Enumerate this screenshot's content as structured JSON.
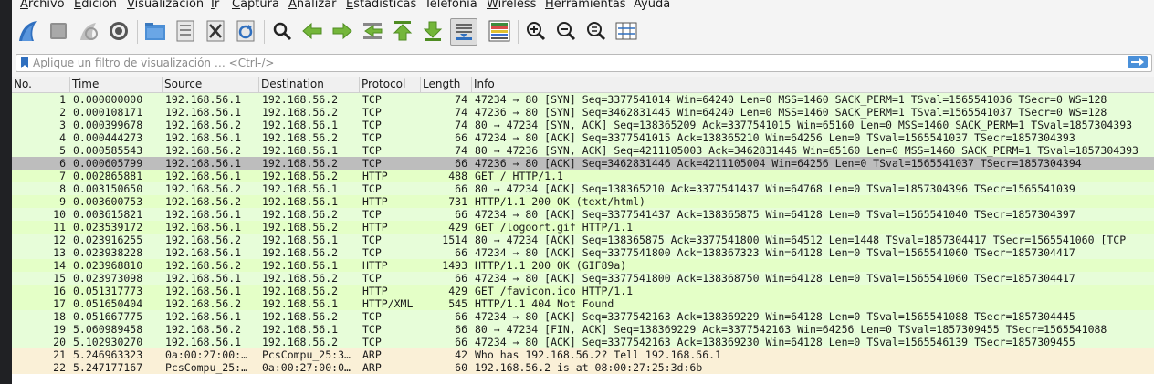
{
  "menu": [
    {
      "mnemonic": "A",
      "rest": "rchivo"
    },
    {
      "mnemonic": "E",
      "rest": "dición"
    },
    {
      "mnemonic": "V",
      "rest": "isualización"
    },
    {
      "mnemonic": "I",
      "rest": "r"
    },
    {
      "mnemonic": "C",
      "rest": "aptura"
    },
    {
      "mnemonic": "A",
      "rest": "nalizar"
    },
    {
      "mnemonic": "E",
      "rest": "stadísticas"
    },
    {
      "mnemonic": "",
      "rest": "Telefonía"
    },
    {
      "mnemonic": "W",
      "rest": "ireless"
    },
    {
      "mnemonic": "H",
      "rest": "erramientas"
    },
    {
      "mnemonic": "",
      "rest": "Ayuda"
    }
  ],
  "toolbar": {
    "icons": [
      "shark-fin-start-icon",
      "stop-capture-icon",
      "restart-capture-icon",
      "capture-options-icon",
      "open-file-icon",
      "save-file-icon",
      "close-file-icon",
      "reload-file-icon",
      "find-packet-icon",
      "go-back-icon",
      "go-forward-icon",
      "go-to-packet-icon",
      "go-first-icon",
      "go-last-icon",
      "auto-scroll-icon",
      "colorize-icon",
      "zoom-in-icon",
      "zoom-out-icon",
      "zoom-normal-icon",
      "resize-columns-icon"
    ]
  },
  "filter": {
    "placeholder": "Aplique un filtro de visualización … <Ctrl-/>"
  },
  "columns": [
    "No.",
    "Time",
    "Source",
    "Destination",
    "Protocol",
    "Length",
    "Info"
  ],
  "colors": {
    "tcp": "#e7fdd9",
    "http": "#e4ffc7",
    "arp": "#faf0d7",
    "selected": "#bdbdbd"
  },
  "packets": [
    {
      "no": "1",
      "time": "0.000000000",
      "src": "192.168.56.1",
      "dst": "192.168.56.2",
      "proto": "TCP",
      "len": "74",
      "info": "47234 → 80 [SYN] Seq=3377541014 Win=64240 Len=0 MSS=1460 SACK_PERM=1 TSval=1565541036 TSecr=0 WS=128",
      "kind": "tcp"
    },
    {
      "no": "2",
      "time": "0.000108171",
      "src": "192.168.56.1",
      "dst": "192.168.56.2",
      "proto": "TCP",
      "len": "74",
      "info": "47236 → 80 [SYN] Seq=3462831445 Win=64240 Len=0 MSS=1460 SACK_PERM=1 TSval=1565541037 TSecr=0 WS=128",
      "kind": "tcp"
    },
    {
      "no": "3",
      "time": "0.000399678",
      "src": "192.168.56.2",
      "dst": "192.168.56.1",
      "proto": "TCP",
      "len": "74",
      "info": "80 → 47234 [SYN, ACK] Seq=138365209 Ack=3377541015 Win=65160 Len=0 MSS=1460 SACK_PERM=1 TSval=1857304393",
      "kind": "tcp"
    },
    {
      "no": "4",
      "time": "0.000444273",
      "src": "192.168.56.1",
      "dst": "192.168.56.2",
      "proto": "TCP",
      "len": "66",
      "info": "47234 → 80 [ACK] Seq=3377541015 Ack=138365210 Win=64256 Len=0 TSval=1565541037 TSecr=1857304393",
      "kind": "tcp"
    },
    {
      "no": "5",
      "time": "0.000585543",
      "src": "192.168.56.2",
      "dst": "192.168.56.1",
      "proto": "TCP",
      "len": "74",
      "info": "80 → 47236 [SYN, ACK] Seq=4211105003 Ack=3462831446 Win=65160 Len=0 MSS=1460 SACK_PERM=1 TSval=1857304393",
      "kind": "tcp"
    },
    {
      "no": "6",
      "time": "0.000605799",
      "src": "192.168.56.1",
      "dst": "192.168.56.2",
      "proto": "TCP",
      "len": "66",
      "info": "47236 → 80 [ACK] Seq=3462831446 Ack=4211105004 Win=64256 Len=0 TSval=1565541037 TSecr=1857304394",
      "kind": "selected"
    },
    {
      "no": "7",
      "time": "0.002865881",
      "src": "192.168.56.1",
      "dst": "192.168.56.2",
      "proto": "HTTP",
      "len": "488",
      "info": "GET / HTTP/1.1",
      "kind": "http"
    },
    {
      "no": "8",
      "time": "0.003150650",
      "src": "192.168.56.2",
      "dst": "192.168.56.1",
      "proto": "TCP",
      "len": "66",
      "info": "80 → 47234 [ACK] Seq=138365210 Ack=3377541437 Win=64768 Len=0 TSval=1857304396 TSecr=1565541039",
      "kind": "tcp"
    },
    {
      "no": "9",
      "time": "0.003600753",
      "src": "192.168.56.2",
      "dst": "192.168.56.1",
      "proto": "HTTP",
      "len": "731",
      "info": "HTTP/1.1 200 OK  (text/html)",
      "kind": "http"
    },
    {
      "no": "10",
      "time": "0.003615821",
      "src": "192.168.56.1",
      "dst": "192.168.56.2",
      "proto": "TCP",
      "len": "66",
      "info": "47234 → 80 [ACK] Seq=3377541437 Ack=138365875 Win=64128 Len=0 TSval=1565541040 TSecr=1857304397",
      "kind": "tcp"
    },
    {
      "no": "11",
      "time": "0.023539172",
      "src": "192.168.56.1",
      "dst": "192.168.56.2",
      "proto": "HTTP",
      "len": "429",
      "info": "GET /logoort.gif HTTP/1.1",
      "kind": "http"
    },
    {
      "no": "12",
      "time": "0.023916255",
      "src": "192.168.56.2",
      "dst": "192.168.56.1",
      "proto": "TCP",
      "len": "1514",
      "info": "80 → 47234 [ACK] Seq=138365875 Ack=3377541800 Win=64512 Len=1448 TSval=1857304417 TSecr=1565541060 [TCP",
      "kind": "tcp"
    },
    {
      "no": "13",
      "time": "0.023938228",
      "src": "192.168.56.1",
      "dst": "192.168.56.2",
      "proto": "TCP",
      "len": "66",
      "info": "47234 → 80 [ACK] Seq=3377541800 Ack=138367323 Win=64128 Len=0 TSval=1565541060 TSecr=1857304417",
      "kind": "tcp"
    },
    {
      "no": "14",
      "time": "0.023968810",
      "src": "192.168.56.2",
      "dst": "192.168.56.1",
      "proto": "HTTP",
      "len": "1493",
      "info": "HTTP/1.1 200 OK  (GIF89a)",
      "kind": "http"
    },
    {
      "no": "15",
      "time": "0.023973098",
      "src": "192.168.56.1",
      "dst": "192.168.56.2",
      "proto": "TCP",
      "len": "66",
      "info": "47234 → 80 [ACK] Seq=3377541800 Ack=138368750 Win=64128 Len=0 TSval=1565541060 TSecr=1857304417",
      "kind": "tcp"
    },
    {
      "no": "16",
      "time": "0.051317773",
      "src": "192.168.56.1",
      "dst": "192.168.56.2",
      "proto": "HTTP",
      "len": "429",
      "info": "GET /favicon.ico HTTP/1.1",
      "kind": "http"
    },
    {
      "no": "17",
      "time": "0.051650404",
      "src": "192.168.56.2",
      "dst": "192.168.56.1",
      "proto": "HTTP/XML",
      "len": "545",
      "info": "HTTP/1.1 404 Not Found",
      "kind": "http"
    },
    {
      "no": "18",
      "time": "0.051667775",
      "src": "192.168.56.1",
      "dst": "192.168.56.2",
      "proto": "TCP",
      "len": "66",
      "info": "47234 → 80 [ACK] Seq=3377542163 Ack=138369229 Win=64128 Len=0 TSval=1565541088 TSecr=1857304445",
      "kind": "tcp"
    },
    {
      "no": "19",
      "time": "5.060989458",
      "src": "192.168.56.2",
      "dst": "192.168.56.1",
      "proto": "TCP",
      "len": "66",
      "info": "80 → 47234 [FIN, ACK] Seq=138369229 Ack=3377542163 Win=64256 Len=0 TSval=1857309455 TSecr=1565541088",
      "kind": "tcp"
    },
    {
      "no": "20",
      "time": "5.102930270",
      "src": "192.168.56.1",
      "dst": "192.168.56.2",
      "proto": "TCP",
      "len": "66",
      "info": "47234 → 80 [ACK] Seq=3377542163 Ack=138369230 Win=64128 Len=0 TSval=1565546139 TSecr=1857309455",
      "kind": "tcp"
    },
    {
      "no": "21",
      "time": "5.246963323",
      "src": "0a:00:27:00:…",
      "dst": "PcsCompu_25:3…",
      "proto": "ARP",
      "len": "42",
      "info": "Who has 192.168.56.2? Tell 192.168.56.1",
      "kind": "arp"
    },
    {
      "no": "22",
      "time": "5.247177167",
      "src": "PcsCompu_25:…",
      "dst": "0a:00:27:00:0…",
      "proto": "ARP",
      "len": "60",
      "info": "192.168.56.2 is at 08:00:27:25:3d:6b",
      "kind": "arp"
    }
  ]
}
